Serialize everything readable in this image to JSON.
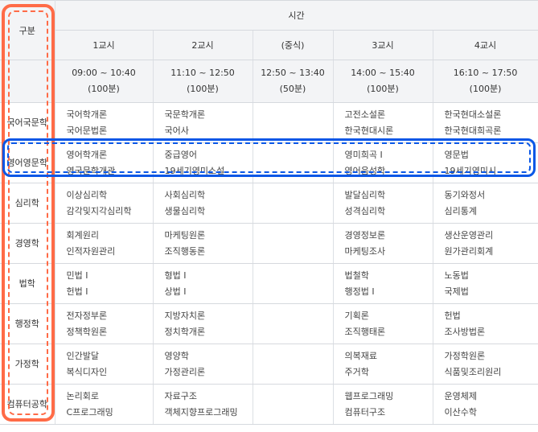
{
  "header": {
    "category": "구분",
    "time": "시간",
    "periods": [
      {
        "label": "1교시",
        "time": "09:00 ~ 10:40",
        "duration": "(100분)"
      },
      {
        "label": "2교시",
        "time": "11:10 ~ 12:50",
        "duration": "(100분)"
      },
      {
        "label": "(중식)",
        "time": "12:50 ~ 13:40",
        "duration": "(50분)"
      },
      {
        "label": "3교시",
        "time": "14:00 ~ 15:40",
        "duration": "(100분)"
      },
      {
        "label": "4교시",
        "time": "16:10 ~ 17:50",
        "duration": "(100분)"
      }
    ]
  },
  "rows": [
    {
      "category": "국어국문학",
      "p1": [
        "국어학개론",
        "국어문법론"
      ],
      "p2": [
        "국문학개론",
        "국어사"
      ],
      "p3": [
        "고전소설론",
        "한국현대시론"
      ],
      "p4": [
        "한국현대소설론",
        "한국현대희곡론"
      ]
    },
    {
      "category": "영어영문학",
      "p1": [
        "영어학개론",
        "영국문학개관"
      ],
      "p2": [
        "중급영어",
        "19세기영미소설"
      ],
      "p3": [
        "영미희곡 I",
        "영어음성학"
      ],
      "p4": [
        "영문법",
        "19세기영미시"
      ]
    },
    {
      "category": "심리학",
      "p1": [
        "이상심리학",
        "감각및지각심리학"
      ],
      "p2": [
        "사회심리학",
        "생물심리학"
      ],
      "p3": [
        "발달심리학",
        "성격심리학"
      ],
      "p4": [
        "동기와정서",
        "심리통계"
      ]
    },
    {
      "category": "경영학",
      "p1": [
        "회계원리",
        "인적자원관리"
      ],
      "p2": [
        "마케팅원론",
        "조직행동론"
      ],
      "p3": [
        "경영정보론",
        "마케팅조사"
      ],
      "p4": [
        "생산운영관리",
        "원가관리회계"
      ]
    },
    {
      "category": "법학",
      "p1": [
        "민법 I",
        "헌법 I"
      ],
      "p2": [
        "형법 I",
        "상법 I"
      ],
      "p3": [
        "법철학",
        "행정법 I"
      ],
      "p4": [
        "노동법",
        "국제법"
      ]
    },
    {
      "category": "행정학",
      "p1": [
        "전자정부론",
        "정책학원론"
      ],
      "p2": [
        "지방자치론",
        "정치학개론"
      ],
      "p3": [
        "기획론",
        "조직행태론"
      ],
      "p4": [
        "헌법",
        "조사방법론"
      ]
    },
    {
      "category": "가정학",
      "p1": [
        "인간발달",
        "복식디자인"
      ],
      "p2": [
        "영양학",
        "가정관리론"
      ],
      "p3": [
        "의복재료",
        "주거학"
      ],
      "p4": [
        "가정학원론",
        "식품및조리원리"
      ]
    },
    {
      "category": "컴퓨터공학",
      "p1": [
        "논리회로",
        "C프로그래밍"
      ],
      "p2": [
        "자료구조",
        "객체지향프로그래밍"
      ],
      "p3": [
        "웹프로그래밍",
        "컴퓨터구조"
      ],
      "p4": [
        "운영체제",
        "이산수학"
      ]
    }
  ],
  "highlights": {
    "category_column_color": "#ff6b47",
    "selected_row_color": "#0a57e6",
    "selected_row": "영어영문학"
  }
}
